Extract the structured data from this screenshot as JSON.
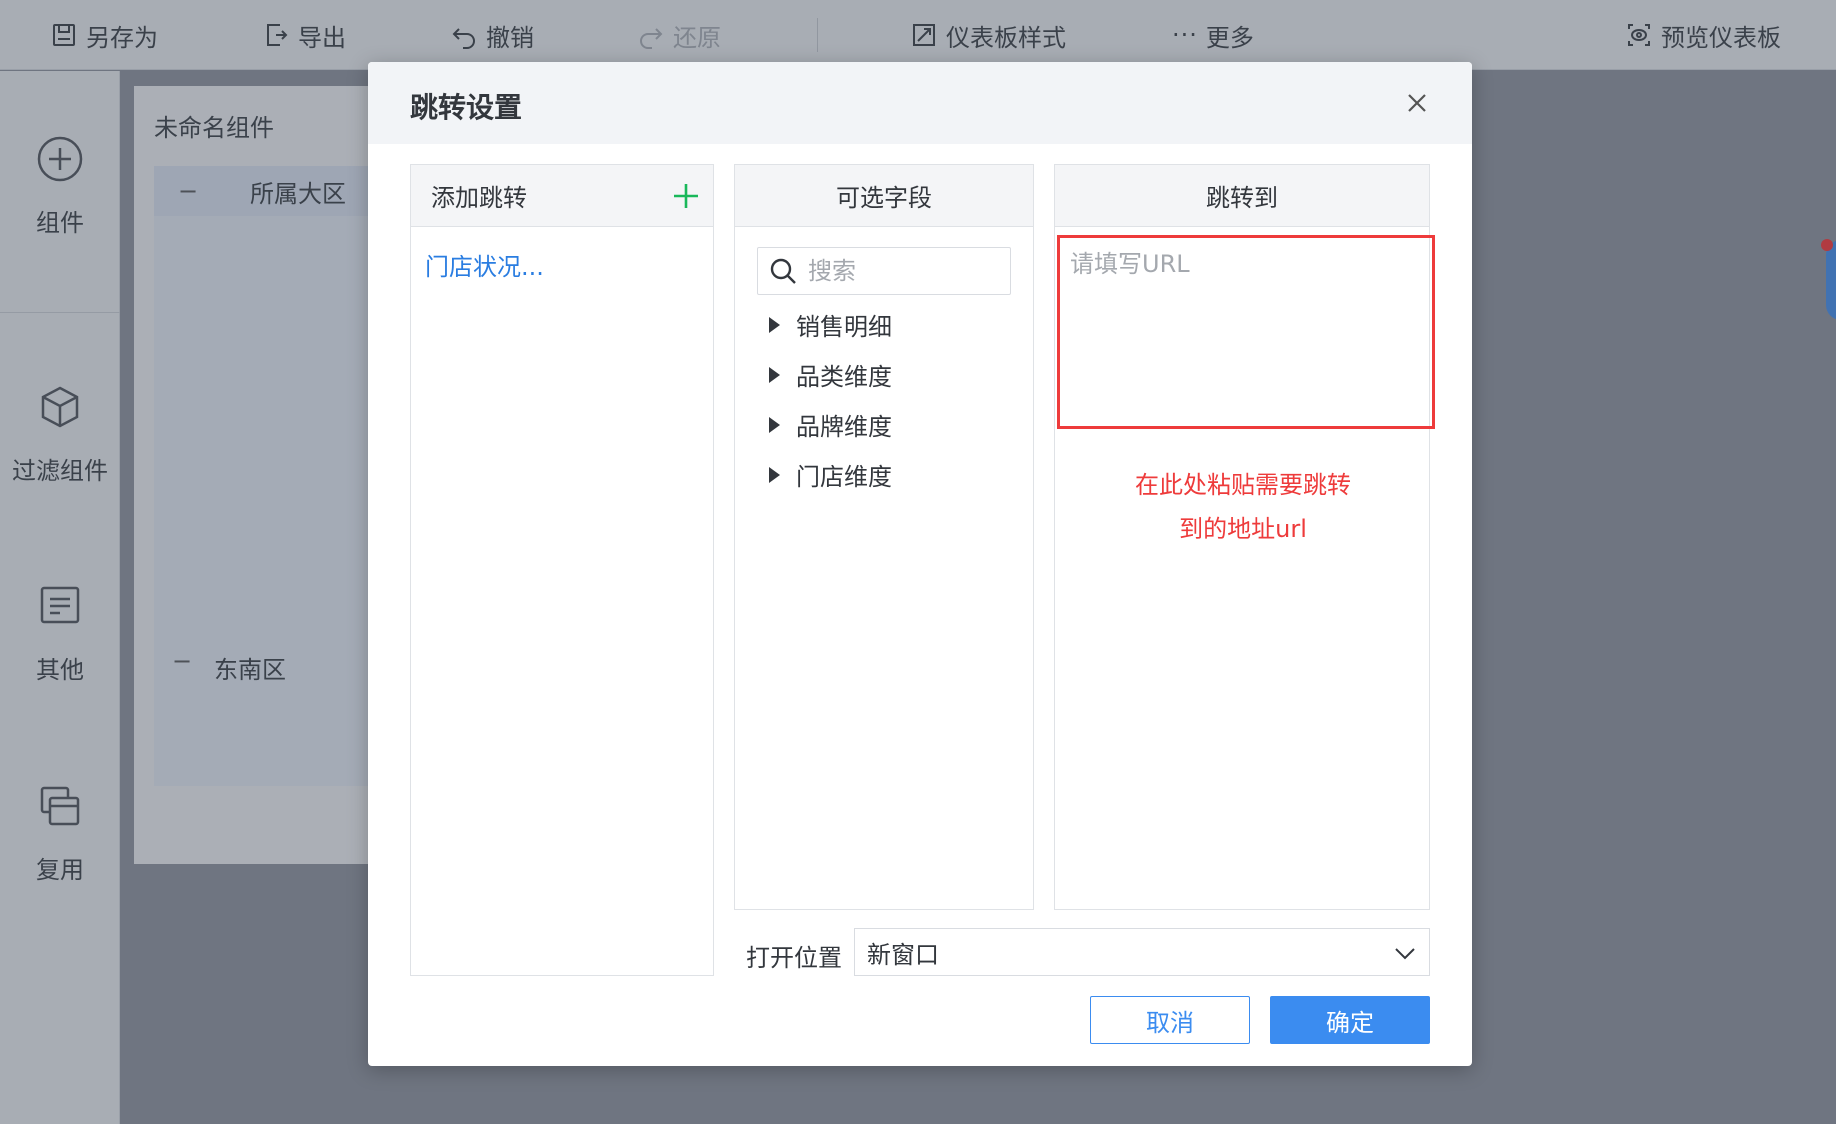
{
  "toolbar": {
    "save_as": "另存为",
    "export": "导出",
    "undo": "撤销",
    "redo": "还原",
    "dashboard_style": "仪表板样式",
    "more": "更多",
    "preview": "预览仪表板"
  },
  "sidebar": {
    "items": [
      {
        "label": "组件",
        "icon": "plus-circle-icon"
      },
      {
        "label": "过滤组件",
        "icon": "cube-icon"
      },
      {
        "label": "其他",
        "icon": "document-icon"
      },
      {
        "label": "复用",
        "icon": "copy-icon"
      }
    ]
  },
  "canvas": {
    "widget_title": "未命名组件",
    "column_header": "所属大区",
    "row_label": "东南区",
    "collapse_symbol": "−"
  },
  "dialog": {
    "title": "跳转设置",
    "add_jump_panel": {
      "title": "添加跳转",
      "items": [
        "门店状况..."
      ]
    },
    "fields_panel": {
      "title": "可选字段",
      "search_placeholder": "搜索",
      "fields": [
        "销售明细",
        "品类维度",
        "品牌维度",
        "门店维度"
      ]
    },
    "jump_to_panel": {
      "title": "跳转到",
      "url_placeholder": "请填写URL",
      "annotation": "在此处粘贴需要跳转\n到的地址url"
    },
    "open_position": {
      "label": "打开位置",
      "selected": "新窗口"
    },
    "buttons": {
      "cancel": "取消",
      "confirm": "确定"
    }
  },
  "colors": {
    "accent": "#3b8cf0",
    "link": "#2a7de1",
    "annotation": "#ee3b3b",
    "add_icon": "#19b85a"
  }
}
